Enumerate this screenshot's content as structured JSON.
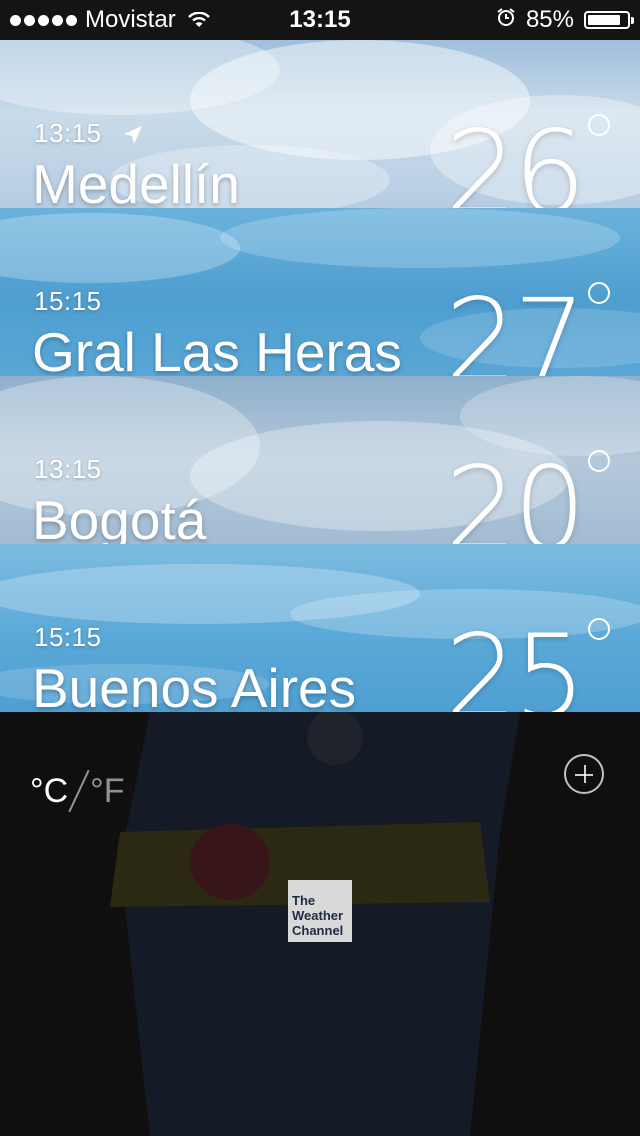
{
  "status_bar": {
    "carrier": "Movistar",
    "time": "13:15",
    "battery_percent": "85%",
    "battery_level": 0.85
  },
  "cities": [
    {
      "time": "13:15",
      "name": "Medellín",
      "temp": "26",
      "current_location": true,
      "bg": "#c2d6e8"
    },
    {
      "time": "15:15",
      "name": "Gral Las Heras",
      "temp": "27",
      "current_location": false,
      "bg": "#4d9fd0"
    },
    {
      "time": "13:15",
      "name": "Bogotá",
      "temp": "20",
      "current_location": false,
      "bg": "#a9bfd3"
    },
    {
      "time": "15:15",
      "name": "Buenos Aires",
      "temp": "25",
      "current_location": false,
      "bg": "#5ca8d6"
    }
  ],
  "units": {
    "celsius": "°C",
    "fahrenheit": "°F"
  },
  "logo": {
    "text": "The Weather Channel"
  },
  "icons": {
    "wifi": "wifi-icon",
    "alarm": "alarm-icon",
    "location": "location-arrow-icon",
    "add": "plus-circle-icon"
  }
}
